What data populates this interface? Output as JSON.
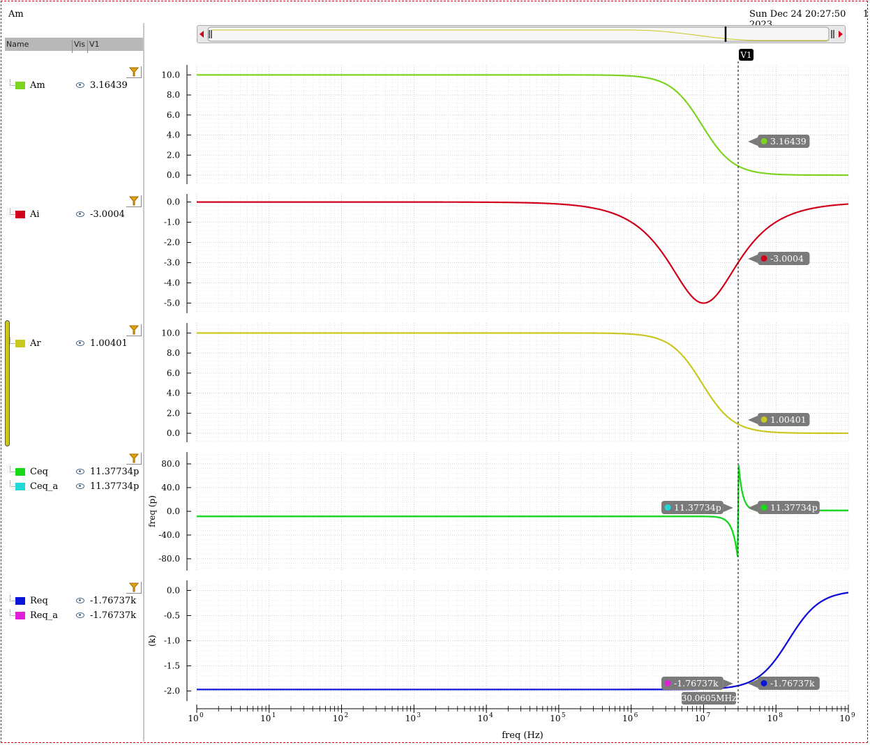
{
  "header": {
    "title": "Am",
    "timestamp": "Sun Dec 24 20:27:50 2023",
    "page": "1"
  },
  "sidebar": {
    "columns": [
      "Name",
      "Vis",
      "V1"
    ],
    "groups": [
      {
        "signals": [
          {
            "name": "Am",
            "value": "3.16439",
            "color": "#7ed321"
          }
        ]
      },
      {
        "signals": [
          {
            "name": "Ai",
            "value": "-3.0004",
            "color": "#d0021b"
          }
        ]
      },
      {
        "signals": [
          {
            "name": "Ar",
            "value": "1.00401",
            "color": "#c8c820"
          }
        ]
      },
      {
        "signals": [
          {
            "name": "Ceq",
            "value": "11.37734p",
            "color": "#18d818"
          },
          {
            "name": "Ceq_a",
            "value": "11.37734p",
            "color": "#20d8d8"
          }
        ]
      },
      {
        "signals": [
          {
            "name": "Req",
            "value": "-1.76737k",
            "color": "#0a14d8"
          },
          {
            "name": "Req_a",
            "value": "-1.76737k",
            "color": "#e020d8"
          }
        ]
      }
    ]
  },
  "cursor": {
    "label": "V1",
    "freq_label": "30.0605MHz",
    "freq_hz": 30060500
  },
  "chart_data": [
    {
      "type": "line",
      "series": [
        {
          "name": "Am",
          "color": "#7ed321",
          "cursor_label": "3.16439"
        }
      ],
      "ylim": [
        -0.9,
        11.0
      ],
      "yticks": [
        "10.0",
        "8.0",
        "6.0",
        "4.0",
        "2.0",
        "0.0"
      ],
      "ylabel": "",
      "log_x": true
    },
    {
      "type": "line",
      "series": [
        {
          "name": "Ai",
          "color": "#d0021b",
          "cursor_label": "-3.0004"
        }
      ],
      "ylim": [
        -5.5,
        0.4
      ],
      "yticks": [
        "0.0",
        "-1.0",
        "-2.0",
        "-3.0",
        "-4.0",
        "-5.0"
      ],
      "ylabel": "",
      "log_x": true
    },
    {
      "type": "line",
      "series": [
        {
          "name": "Ar",
          "color": "#c8c820",
          "cursor_label": "1.00401"
        }
      ],
      "ylim": [
        -0.9,
        11.0
      ],
      "yticks": [
        "10.0",
        "8.0",
        "6.0",
        "4.0",
        "2.0",
        "0.0"
      ],
      "ylabel": "",
      "log_x": true
    },
    {
      "type": "line",
      "series": [
        {
          "name": "Ceq_a",
          "color": "#20d8d8",
          "cursor_label": "11.37734p"
        },
        {
          "name": "Ceq",
          "color": "#18d818",
          "cursor_label": "11.37734p"
        }
      ],
      "ylim": [
        -100,
        100
      ],
      "yticks": [
        "80.0",
        "40.0",
        "0.0",
        "-40.0",
        "-80.0"
      ],
      "ylabel": "freq (p)",
      "log_x": true
    },
    {
      "type": "line",
      "series": [
        {
          "name": "Req_a",
          "color": "#e020d8",
          "cursor_label": "-1.76737k"
        },
        {
          "name": "Req",
          "color": "#0a14d8",
          "cursor_label": "-1.76737k"
        }
      ],
      "ylim": [
        -2.2,
        0.2
      ],
      "yticks": [
        "0.0",
        "-0.5",
        "-1.0",
        "-1.5",
        "-2.0"
      ],
      "ylabel": "(k)",
      "log_x": true
    }
  ],
  "x_axis": {
    "label": "freq (Hz)",
    "xlim": [
      1,
      1000000000
    ],
    "tick_exponents": [
      "0",
      "1",
      "2",
      "3",
      "4",
      "5",
      "6",
      "7",
      "8",
      "9"
    ]
  }
}
